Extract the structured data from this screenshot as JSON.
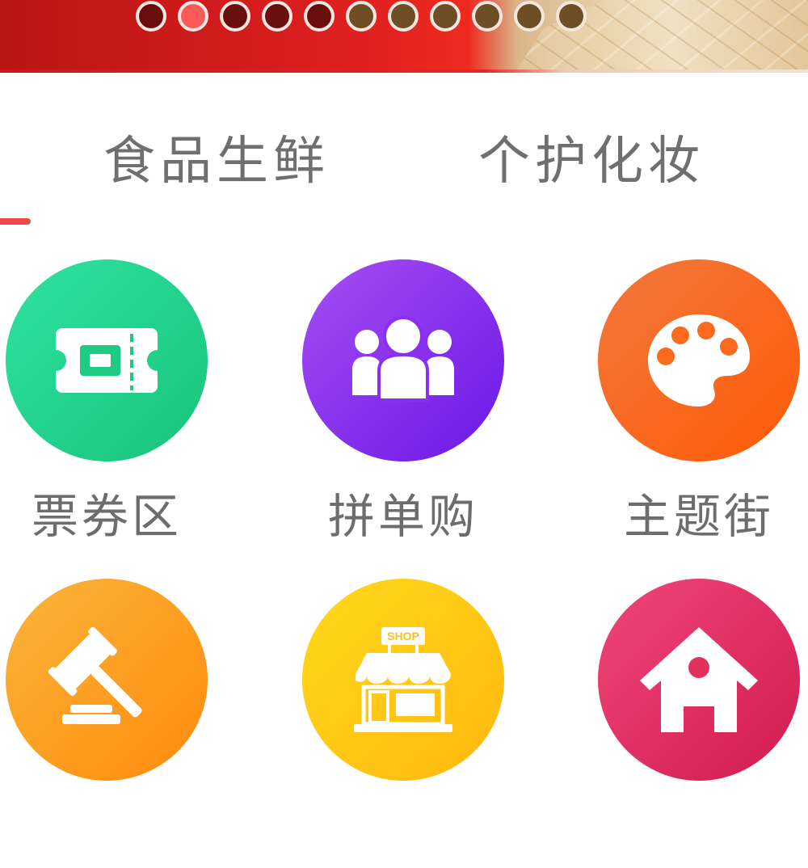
{
  "banner": {
    "icon": "cracker-food-banner",
    "dot_count": 11,
    "active_dot_index": 1
  },
  "tabs": [
    {
      "label": "食品生鲜"
    },
    {
      "label": "个护化妆"
    }
  ],
  "colors": {
    "tab_indicator": "#ef4a4a",
    "tab_text": "#6f6f6f",
    "label_text": "#6d6d6d"
  },
  "categories": [
    {
      "label": "票券区",
      "icon": "ticket-icon",
      "color": "#1fd08a"
    },
    {
      "label": "拼单购",
      "icon": "group-people-icon",
      "color": "#8a2ff0"
    },
    {
      "label": "主题街",
      "icon": "palette-icon",
      "color": "#fb6a1e"
    },
    {
      "label": "",
      "icon": "auction-hammer-icon",
      "color": "#fca022"
    },
    {
      "label": "",
      "icon": "shop-icon",
      "color": "#ffc815"
    },
    {
      "label": "",
      "icon": "house-icon",
      "color": "#e2305f"
    }
  ]
}
